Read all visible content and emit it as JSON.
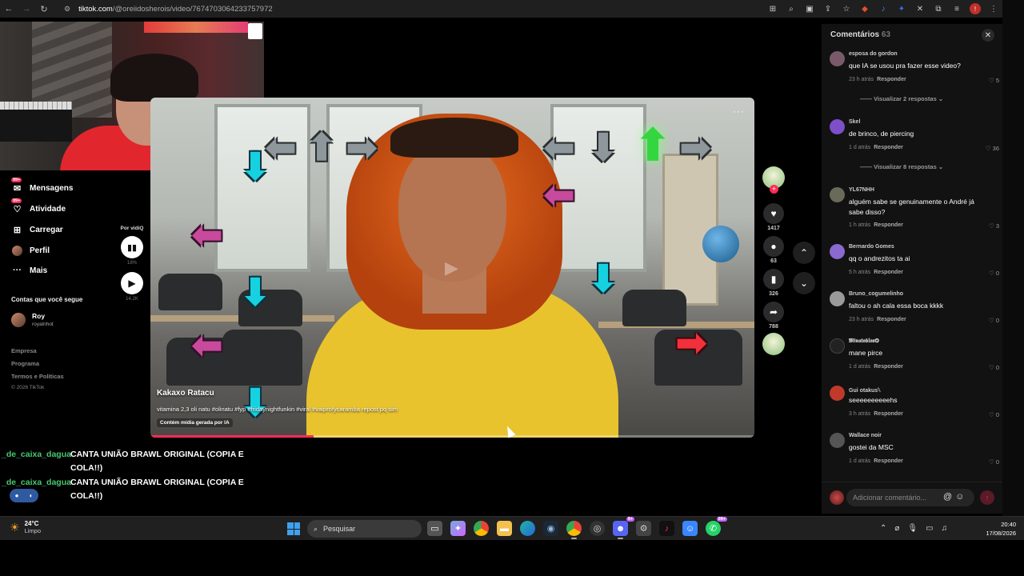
{
  "browser": {
    "url_domain": "tiktok.com",
    "url_path": "/@oreiidosherois/video/7674703064233757972"
  },
  "sidebar": {
    "items": [
      {
        "label": "Mensagens",
        "icon": "messages-icon",
        "badge": "99+"
      },
      {
        "label": "Atividade",
        "icon": "activity-icon",
        "badge": "99+"
      },
      {
        "label": "Carregar",
        "icon": "upload-icon"
      },
      {
        "label": "Perfil",
        "icon": "profile-icon"
      },
      {
        "label": "Mais",
        "icon": "more-icon"
      }
    ],
    "following_heading": "Contas que você segue",
    "following": [
      {
        "name": "Roy",
        "handle": "royalnhot"
      }
    ],
    "footer": [
      "Empresa",
      "Programa",
      "Termos e Políticas"
    ],
    "copyright": "© 2026 TikTok"
  },
  "audio_panel": {
    "label": "Por vidiQ",
    "percent": "18%",
    "count": "14.2K"
  },
  "video": {
    "author": "Kakaxo Ratacu",
    "description": "vitamina 2,3 oli natu #olinatu #fyp #fridaynightfunkin #viral #vaiprofycaramba repost pq sim",
    "ai_label": "Contém mídia gerada por IA",
    "more_label": "···",
    "progress": 0.27
  },
  "actions": {
    "likes": "1417",
    "comments": "63",
    "saves": "326",
    "shares": "788"
  },
  "comments_panel": {
    "title": "Comentários",
    "count": "63",
    "input_placeholder": "Adicionar comentário...",
    "reply_label": "Responder",
    "items": [
      {
        "user": "esposa do gordon",
        "text": "que IA se usou pra fazer esse video?",
        "time": "23 h atrás",
        "likes": "5",
        "replies": "Visualizar 2 respostas",
        "avatar_color": "#7a5a6a"
      },
      {
        "user": "Skel",
        "text": "de brinco, de piercing",
        "time": "1 d atrás",
        "likes": "36",
        "replies": "Visualizar 8 respostas",
        "avatar_color": "#7d4fc9"
      },
      {
        "user": "YL67NHH",
        "text": "alguém sabe se genuinamente o André já sabe disso?",
        "time": "1 h atrás",
        "likes": "3",
        "avatar_color": "#6a6a5a"
      },
      {
        "user": "Bernardo Gomes",
        "text": "qq o andrezitos ta ai",
        "time": "5 h atrás",
        "likes": "0",
        "avatar_color": "#8a6ad0"
      },
      {
        "user": "Bruno_cogumelinho",
        "text": "faltou o ah cala essa boca kkkk",
        "time": "23 h atrás",
        "likes": "0",
        "avatar_color": "#9a9a9a"
      },
      {
        "user": "𝕸𝖎𝖓𝖆𝖙𝖔𝖇𝖑𝖔𝖝✪",
        "text": "mane pirce",
        "time": "1 d atrás",
        "likes": "0",
        "avatar_color": "#222222"
      },
      {
        "user": "Gui otakus𓆩",
        "text": "seeeeeeeeeehs",
        "time": "3 h atrás",
        "likes": "0",
        "avatar_color": "#c0392b"
      },
      {
        "user": "Wallace noir",
        "text": "gostei da MSC",
        "time": "1 d atrás",
        "likes": "0",
        "avatar_color": "#555555"
      }
    ]
  },
  "stream_chat": [
    {
      "user": "_de_caixa_dagua",
      "message": "CANTA UNIÃO BRAWL ORIGINAL (COPIA E COLA!!)"
    },
    {
      "user": "_de_caixa_dagua",
      "message": "CANTA UNIÃO BRAWL ORIGINAL (COPIA E COLA!!)"
    }
  ],
  "taskbar": {
    "temperature": "24°C",
    "condition": "Limpo",
    "search_label": "Pesquisar",
    "time": "20:40",
    "date": "17/08/2026",
    "badge_discord": "9+",
    "badge_whatsapp": "99+"
  }
}
